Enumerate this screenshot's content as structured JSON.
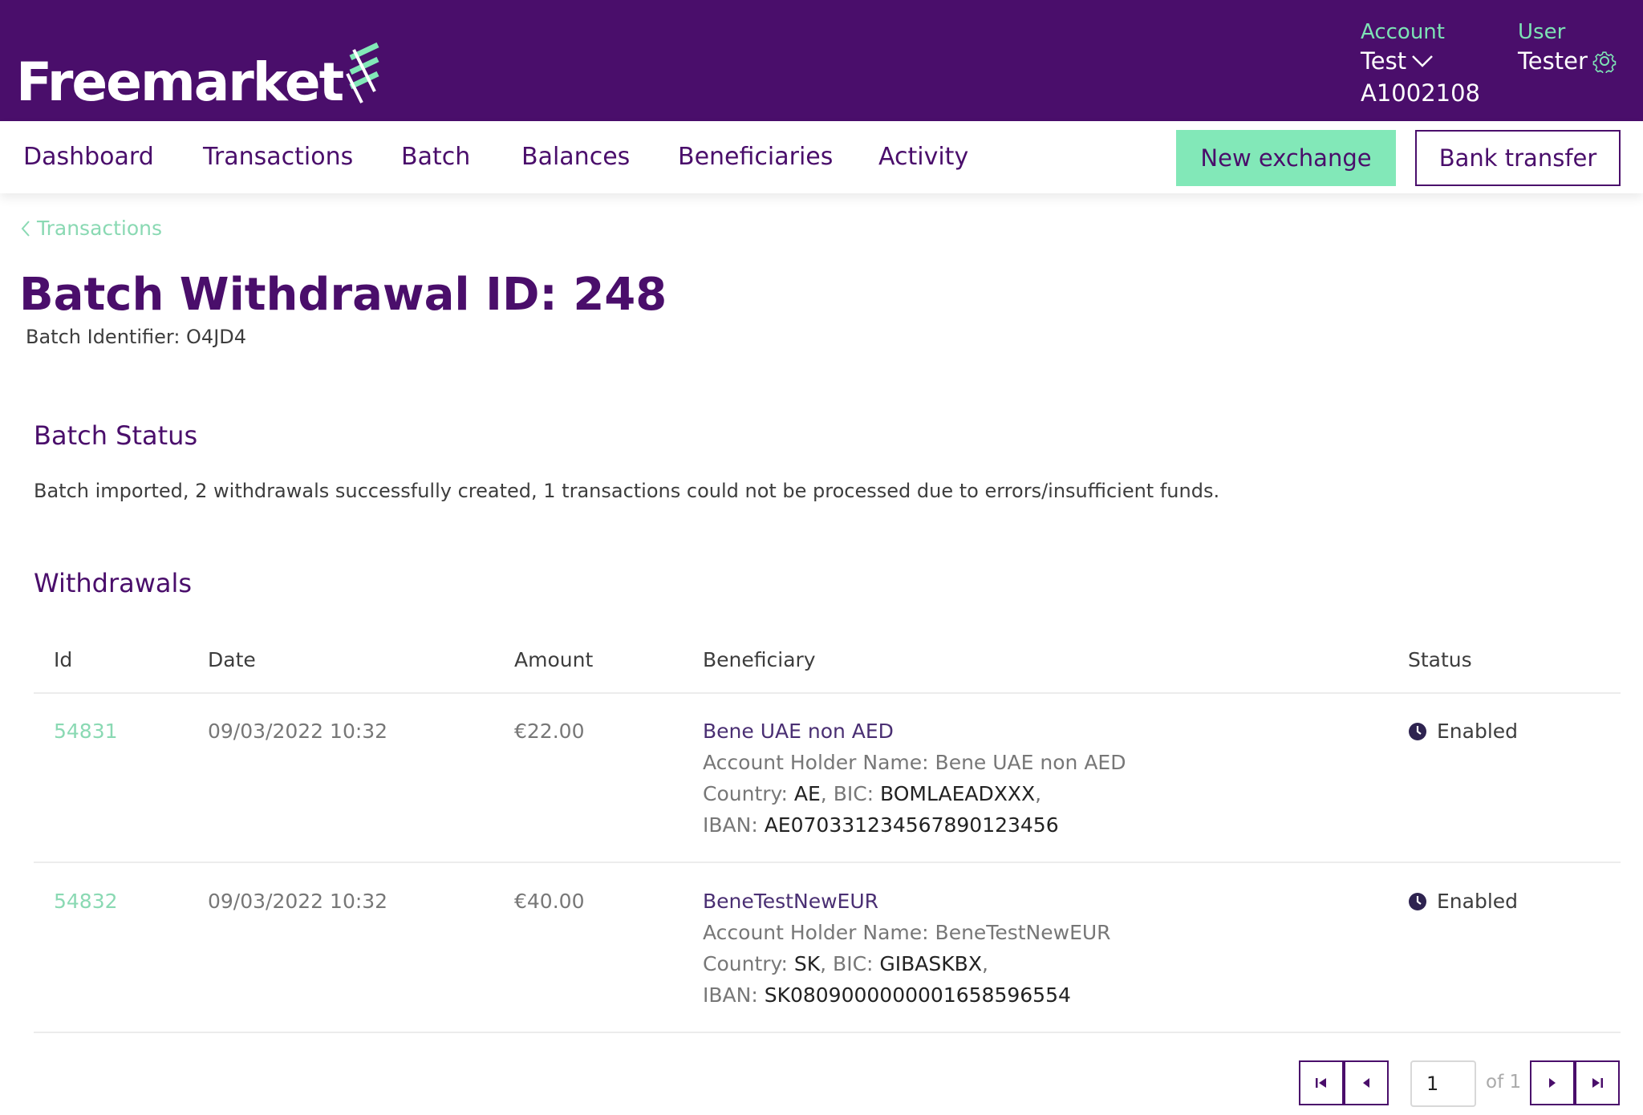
{
  "brand": {
    "name": "Freemarket"
  },
  "header": {
    "account_label": "Account",
    "account_name": "Test",
    "account_id": "A1002108",
    "user_label": "User",
    "user_name": "Tester"
  },
  "nav": {
    "items": [
      "Dashboard",
      "Transactions",
      "Batch",
      "Balances",
      "Beneficiaries",
      "Activity"
    ],
    "new_exchange": "New exchange",
    "bank_transfer": "Bank transfer"
  },
  "breadcrumb": {
    "back_label": "Transactions"
  },
  "page": {
    "title": "Batch Withdrawal ID: 248",
    "subtitle": "Batch Identifier: O4JD4"
  },
  "batch_status": {
    "heading": "Batch Status",
    "text": "Batch imported, 2 withdrawals successfully created, 1 transactions could not be processed due to errors/insufficient funds."
  },
  "withdrawals": {
    "heading": "Withdrawals",
    "columns": [
      "Id",
      "Date",
      "Amount",
      "Beneficiary",
      "Status"
    ],
    "rows": [
      {
        "id": "54831",
        "date": "09/03/2022 10:32",
        "amount": "€22.00",
        "beneficiary": "Bene UAE non AED",
        "holder_label": "Account Holder Name:",
        "holder": "Bene UAE non AED",
        "country_label": "Country:",
        "country": "AE",
        "bic_label": "BIC:",
        "bic": "BOMLAEADXXX",
        "iban_label": "IBAN:",
        "iban": "AE070331234567890123456",
        "status": "Enabled"
      },
      {
        "id": "54832",
        "date": "09/03/2022 10:32",
        "amount": "€40.00",
        "beneficiary": "BeneTestNewEUR",
        "holder_label": "Account Holder Name:",
        "holder": "BeneTestNewEUR",
        "country_label": "Country:",
        "country": "SK",
        "bic_label": "BIC:",
        "bic": "GIBASKBX",
        "iban_label": "IBAN:",
        "iban": "SK0809000000001658596554",
        "status": "Enabled"
      }
    ]
  },
  "pagination": {
    "current": "1",
    "of_label": "of 1"
  },
  "colors": {
    "brand_purple": "#4a0e6b",
    "accent_green": "#82e8b8",
    "link_green": "#8ad9b3"
  },
  "icons": [
    "logo-mark-icon",
    "chevron-down-icon",
    "gear-icon",
    "chevron-left-icon",
    "clock-icon",
    "first-page-icon",
    "prev-page-icon",
    "next-page-icon",
    "last-page-icon"
  ]
}
